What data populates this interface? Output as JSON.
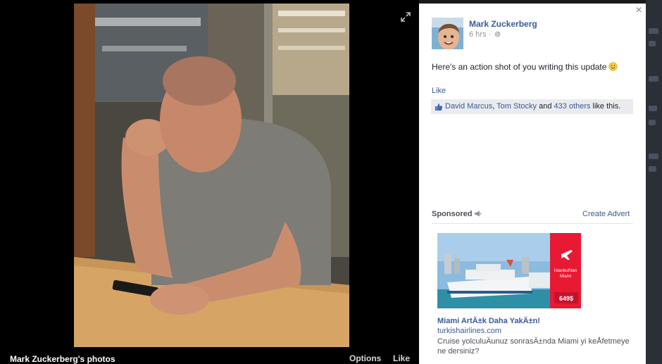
{
  "viewer": {
    "owner_label": "Mark Zuckerberg's photos",
    "options_label": "Options",
    "like_label": "Like"
  },
  "post": {
    "author": "Mark Zuckerberg",
    "time": "6 hrs",
    "separator": "·",
    "text": "Here's an action shot of you writing this update",
    "like_action": "Like",
    "likes": {
      "name1": "David Marcus",
      "sep": ", ",
      "name2": "Tom Stocky",
      "and": " and ",
      "others": "433 others",
      "suffix": " like this."
    },
    "close_glyph": "×"
  },
  "sponsored": {
    "label": "Sponsored",
    "create_advert": "Create Advert",
    "ad": {
      "image_text_line1": "İstanbul'dan",
      "image_text_line2": "Miami",
      "price": "649$",
      "title": "Miami ArtÄ±k Daha YakÄ±n!",
      "domain": "turkishairlines.com",
      "body": "Cruise yolculuÄunuz sonrasÄ±nda Miami yi keÅfetmeye ne dersiniz?"
    }
  },
  "icons": {
    "expand": "expand-icon",
    "globe": "globe-icon",
    "smile": "smile-emoji-icon",
    "thumb": "thumbs-up-icon",
    "megaphone": "megaphone-icon"
  },
  "colors": {
    "link": "#3b5998",
    "brand_red": "#e81932"
  }
}
